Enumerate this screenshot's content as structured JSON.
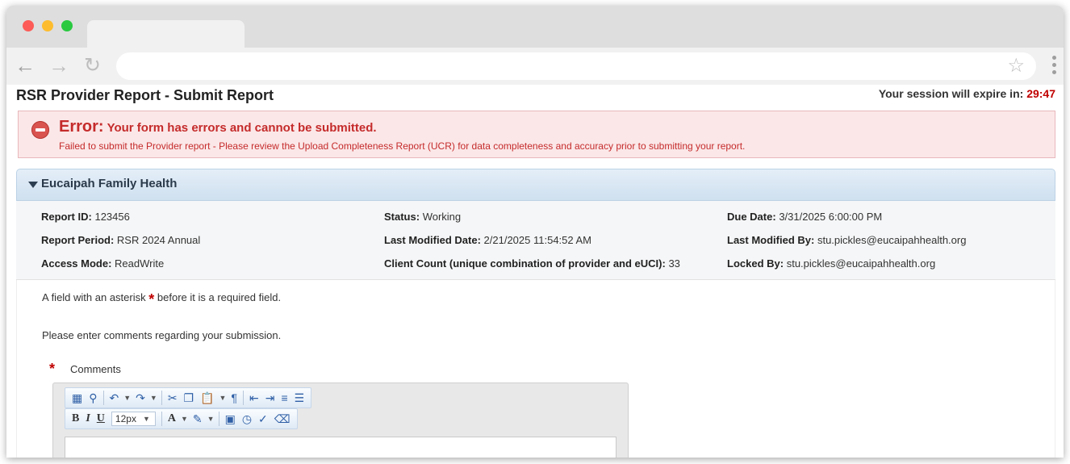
{
  "browser": {
    "url": ""
  },
  "page": {
    "title": "RSR Provider Report - Submit Report",
    "session_prefix": "Your session will expire in:",
    "session_time": "29:47"
  },
  "alert": {
    "label": "Error:",
    "message": "Your form has errors and cannot be submitted.",
    "detail": "Failed to submit the Provider report - Please review the Upload Completeness Report (UCR) for data completeness and accuracy prior to submitting your report."
  },
  "panel": {
    "title": "Eucaipah Family Health"
  },
  "info": {
    "report_id_label": "Report ID:",
    "report_id": "123456",
    "status_label": "Status:",
    "status": "Working",
    "due_date_label": "Due Date:",
    "due_date": "3/31/2025 6:00:00 PM",
    "report_period_label": "Report Period:",
    "report_period": "RSR 2024 Annual",
    "last_modified_date_label": "Last Modified Date:",
    "last_modified_date": "2/21/2025 11:54:52 AM",
    "last_modified_by_label": "Last Modified By:",
    "last_modified_by": "stu.pickles@eucaipahhealth.org",
    "access_mode_label": "Access Mode:",
    "access_mode": "ReadWrite",
    "client_count_label": "Client Count (unique combination of provider and eUCI):",
    "client_count": "33",
    "locked_by_label": "Locked By:",
    "locked_by": "stu.pickles@eucaipahhealth.org"
  },
  "form": {
    "required_note_before": "A field with an asterisk",
    "required_note_after": "before it is a required field.",
    "asterisk": "*",
    "instructions": "Please enter comments regarding your submission.",
    "comments_label": "Comments",
    "font_size": "12px"
  },
  "editor": {
    "row1_icons": [
      "select-all-icon",
      "find-icon",
      "undo-icon",
      "redo-icon",
      "cut-icon",
      "copy-icon",
      "paste-icon",
      "paragraph-icon",
      "outdent-icon",
      "indent-icon",
      "bullet-list-icon",
      "numbered-list-icon"
    ],
    "row2_icons": [
      "bold-icon",
      "italic-icon",
      "underline-icon",
      "font-color-icon",
      "highlight-icon",
      "insert-field-icon",
      "time-icon",
      "spellcheck-icon",
      "clear-format-icon"
    ]
  }
}
